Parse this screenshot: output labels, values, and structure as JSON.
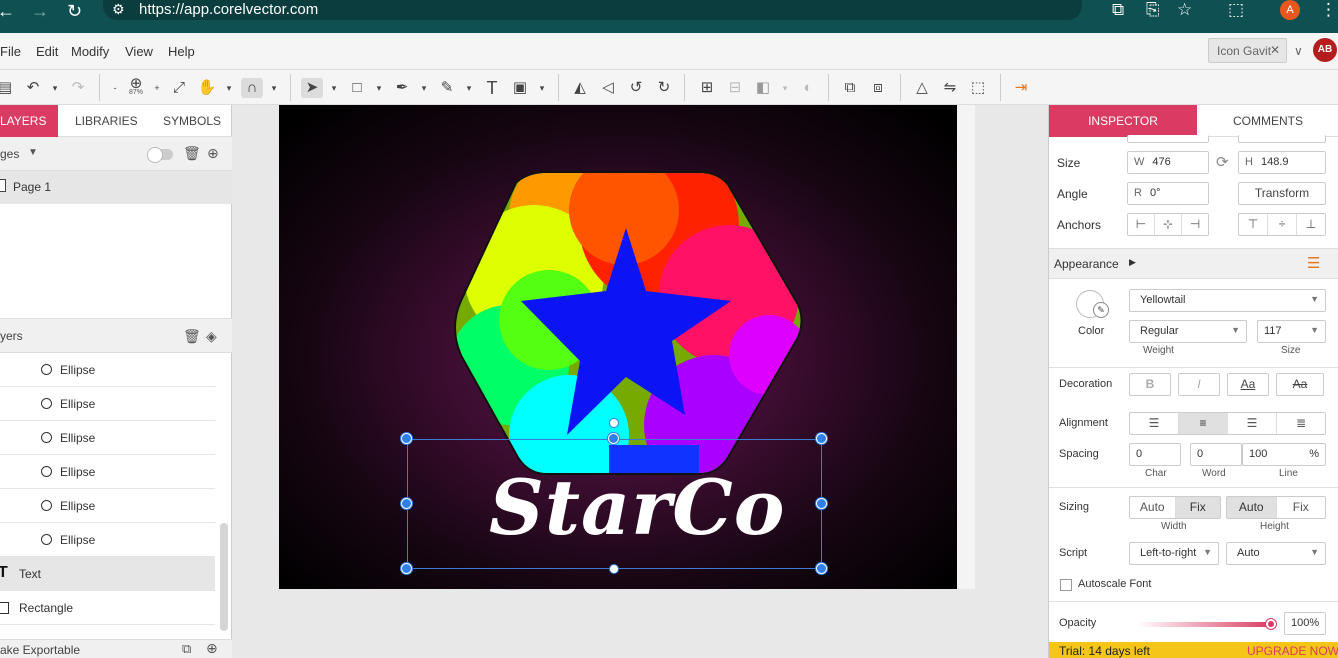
{
  "browser": {
    "url": "https://app.corelvector.com",
    "profile_initial": "A"
  },
  "menu": {
    "items": [
      "File",
      "Edit",
      "Modify",
      "View",
      "Help"
    ],
    "document_tab": "Icon Gavit",
    "user_initials": "AB"
  },
  "toolbar": {
    "zoom_label": "87%"
  },
  "left_panel": {
    "tabs": [
      "LAYERS",
      "LIBRARIES",
      "SYMBOLS"
    ],
    "pages_title": "ges",
    "page_name": "Page 1",
    "layers_title": "yers",
    "layers": [
      {
        "name": "Ellipse",
        "type": "ellipse"
      },
      {
        "name": "Ellipse",
        "type": "ellipse"
      },
      {
        "name": "Ellipse",
        "type": "ellipse"
      },
      {
        "name": "Ellipse",
        "type": "ellipse"
      },
      {
        "name": "Ellipse",
        "type": "ellipse"
      },
      {
        "name": "Ellipse",
        "type": "ellipse"
      },
      {
        "name": "Text",
        "type": "text"
      },
      {
        "name": "Rectangle",
        "type": "rectangle"
      }
    ],
    "export_label": "ake Exportable"
  },
  "canvas": {
    "logo_text": "StarCo"
  },
  "inspector": {
    "tabs": [
      "INSPECTOR",
      "COMMENTS"
    ],
    "size_label": "Size",
    "width_prefix": "W",
    "width": "476",
    "height_prefix": "H",
    "height": "148.9",
    "angle_label": "Angle",
    "angle_prefix": "R",
    "angle": "0°",
    "transform_button": "Transform",
    "anchors_label": "Anchors",
    "appearance_label": "Appearance",
    "font_family": "Yellowtail",
    "color_label": "Color",
    "weight_value": "Regular",
    "weight_label": "Weight",
    "size_value": "117",
    "size_caption": "Size",
    "decoration_label": "Decoration",
    "decoration_buttons": [
      "B",
      "I",
      "Aa",
      "Aa"
    ],
    "alignment_label": "Alignment",
    "spacing_label": "Spacing",
    "spacing_char": "0",
    "spacing_word": "0",
    "spacing_line": "100",
    "spacing_unit": "%",
    "char_label": "Char",
    "word_label": "Word",
    "line_label": "Line",
    "sizing_label": "Sizing",
    "width_sizing": [
      "Auto",
      "Fix"
    ],
    "height_sizing": [
      "Auto",
      "Fix"
    ],
    "width_caption": "Width",
    "height_caption": "Height",
    "script_label": "Script",
    "script_direction": "Left-to-right",
    "script_mode": "Auto",
    "autoscale_label": "Autoscale Font",
    "opacity_label": "Opacity",
    "opacity_value": "100%",
    "opacity_level": 1.0
  },
  "trial": {
    "text": "Trial: 14 days left",
    "upgrade": "UPGRADE NOW"
  },
  "colors": {
    "accent": "#d93b62",
    "browser_bar": "#0f5152",
    "selection": "#2f80ed",
    "trial_bar": "#f5c518"
  }
}
